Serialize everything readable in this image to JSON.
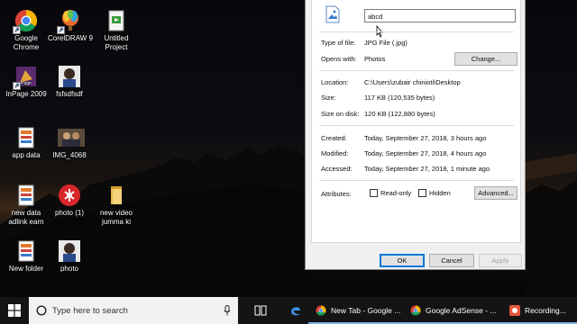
{
  "desktop_icons": [
    {
      "name": "desktop-icon-google-chrome",
      "label": "Google\nChrome",
      "icon": "chrome-icon",
      "shortcut": true
    },
    {
      "name": "desktop-icon-coreldraw",
      "label": "CorelDRAW 9",
      "icon": "coreldraw-icon",
      "shortcut": true
    },
    {
      "name": "desktop-icon-untitled-project",
      "label": "Untitled\nProject",
      "icon": "file-icon",
      "shortcut": false
    },
    {
      "name": "desktop-icon-inpage",
      "label": "InPage 2009",
      "icon": "inpage-icon",
      "shortcut": true
    },
    {
      "name": "desktop-icon-fsfsdfsdf",
      "label": "fsfsdfsdf",
      "icon": "image-thumb-icon",
      "shortcut": false
    },
    {
      "name": "desktop-icon-app-data",
      "label": "app data",
      "icon": "document-icon",
      "shortcut": false
    },
    {
      "name": "desktop-icon-img-4068",
      "label": "IMG_4068",
      "icon": "image-thumb-icon",
      "shortcut": false
    },
    {
      "name": "desktop-icon-new-data",
      "label": "new data\nadlink earn",
      "icon": "document-icon",
      "shortcut": false
    },
    {
      "name": "desktop-icon-photo-1",
      "label": "photo (1)",
      "icon": "image-thumb-icon",
      "shortcut": false
    },
    {
      "name": "desktop-icon-new-video",
      "label": "new video\njumma ki",
      "icon": "folder-icon",
      "shortcut": false
    },
    {
      "name": "desktop-icon-new-folder",
      "label": "New folder",
      "icon": "document-icon",
      "shortcut": false
    },
    {
      "name": "desktop-icon-photo",
      "label": "photo",
      "icon": "image-thumb-icon",
      "shortcut": false
    }
  ],
  "dialog": {
    "filename": "abcd",
    "type_label": "Type of file:",
    "type_value": "JPG File (.jpg)",
    "opens_label": "Opens with:",
    "opens_value": "Photos",
    "change_button": "Change...",
    "location_label": "Location:",
    "location_value": "C:\\Users\\zubair chinioti\\Desktop",
    "size_label": "Size:",
    "size_value": "117 KB (120,535 bytes)",
    "size_disk_label": "Size on disk:",
    "size_disk_value": "120 KB (122,880 bytes)",
    "created_label": "Created:",
    "created_value": "Today, September 27, 2018, 3 hours ago",
    "modified_label": "Modified:",
    "modified_value": "Today, September 27, 2018, 4 hours ago",
    "accessed_label": "Accessed:",
    "accessed_value": "Today, September 27, 2018, 1 minute ago",
    "attributes_label": "Attributes:",
    "readonly_label": "Read-only",
    "hidden_label": "Hidden",
    "advanced_button": "Advanced...",
    "ok_button": "OK",
    "cancel_button": "Cancel",
    "apply_button": "Apply"
  },
  "taskbar": {
    "search_placeholder": "Type here to search",
    "apps": [
      {
        "name": "taskbar-app-new-tab",
        "label": "New Tab - Google ...",
        "icon": "chrome-icon"
      },
      {
        "name": "taskbar-app-google-adsense",
        "label": "Google AdSense - ...",
        "icon": "chrome-icon"
      },
      {
        "name": "taskbar-app-recording",
        "label": "Recording...",
        "icon": "recorder-icon"
      }
    ]
  },
  "colors": {
    "accent": "#0078d7",
    "taskbar": "#141414",
    "dialog_bg": "#f0f0f0"
  }
}
